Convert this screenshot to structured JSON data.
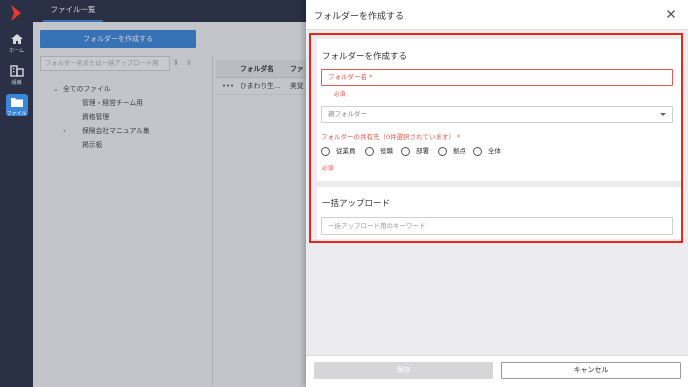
{
  "rail": {
    "items": [
      {
        "label": "ホーム",
        "icon": "home-icon"
      },
      {
        "label": "組織",
        "icon": "organization-icon"
      },
      {
        "label": "ファイル",
        "icon": "folder-icon"
      }
    ]
  },
  "topbar": {
    "tab_label": "ファイル一覧"
  },
  "left": {
    "create_button": "フォルダーを作成する",
    "search_placeholder": "フォルダー名または一括アップロード用",
    "tree": {
      "root": "全てのファイル",
      "children": [
        "管理・経営チーム用",
        "資格管理",
        "保険会社マニュアル集",
        "掲示板"
      ]
    }
  },
  "table": {
    "headers": [
      "フォルダ名",
      "ファ"
    ],
    "row": {
      "dots": "•••",
      "name": "ひまわり生…",
      "col2": "美覚"
    }
  },
  "panel": {
    "title": "フォルダーを作成する",
    "section_title": "フォルダーを作成する",
    "name_placeholder": "フォルダー名 *",
    "required": "必須",
    "parent_placeholder": "親フォルダー",
    "share_label": "フォルダーの共有先（0件選択されています） *",
    "share_options": [
      "従業員",
      "役職",
      "部署",
      "拠点",
      "全体"
    ],
    "bulk_title": "一括アップロード",
    "bulk_placeholder": "一括アップロード用のキーワード",
    "save_label": "保存",
    "cancel_label": "キャンセル"
  },
  "colors": {
    "rail": "#2a3146",
    "accent": "#3b86d9",
    "highlight": "#e8271c",
    "error": "#e25a50",
    "disabled": "#d6d6d9"
  }
}
